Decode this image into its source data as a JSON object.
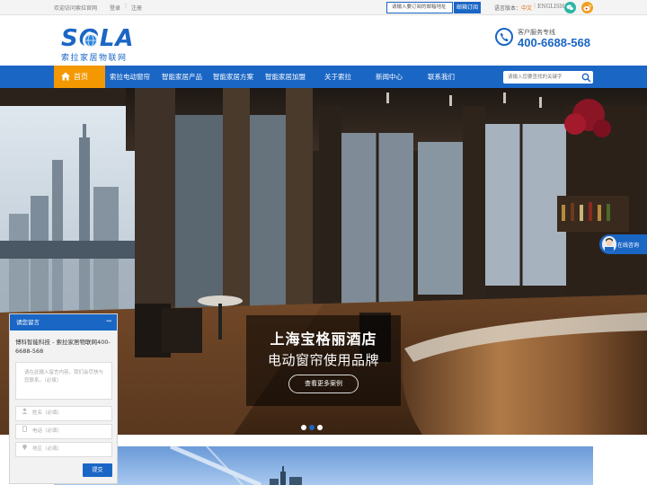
{
  "topbar": {
    "welcome": "欢迎访问索拉官网",
    "login": "登录",
    "separator": "|",
    "register": "注册",
    "subscribe_placeholder": "请输入要订阅的邮箱地址",
    "subscribe_button": "邮箱订阅",
    "language_label": "语言版本：",
    "language_cn": "中文",
    "language_separator": "|",
    "language_en": "ENGLISH",
    "social_icons": [
      "wechat-icon",
      "weibo-icon"
    ]
  },
  "header": {
    "logo_text": "SOLA",
    "logo_subtitle": "索拉家居物联网",
    "service_label": "客户服务专线",
    "service_phone": "400-6688-568",
    "brand_color": "#1a66c5"
  },
  "nav": {
    "home": "首页",
    "items": [
      "索拉电动窗帘",
      "智能家居产品",
      "智能家居方案",
      "智能家居加盟",
      "关于索拉",
      "新闻中心",
      "联系我们"
    ],
    "search_placeholder": "请输入您要查找的关键字",
    "home_color": "#f39800"
  },
  "banner": {
    "title": "上海宝格丽酒店",
    "subtitle": "电动窗帘使用品牌",
    "button": "查看更多案例",
    "slides": 3,
    "active_slide": 2
  },
  "chat": {
    "label": "在线咨询"
  },
  "message_panel": {
    "title": "请您留言",
    "minimize": "−",
    "company": "博科智能科技 - 索拉家居物联网400-6688-568",
    "textarea_placeholder": "请在此输入留言内容，我们会尽快与您联系。（必填）",
    "fields": [
      {
        "icon": "user-icon",
        "placeholder": "姓名（必填）"
      },
      {
        "icon": "phone-icon",
        "placeholder": "电话（必填）"
      },
      {
        "icon": "location-icon",
        "placeholder": "地区（必填）"
      }
    ],
    "submit": "提交"
  }
}
